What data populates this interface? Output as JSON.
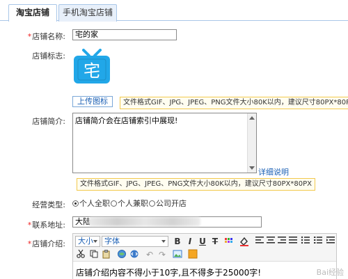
{
  "tabs": [
    {
      "label": "淘宝店铺",
      "active": true
    },
    {
      "label": "手机淘宝店铺",
      "active": false
    }
  ],
  "form": {
    "shop_name": {
      "label": "店铺名称:",
      "required": true,
      "value": "宅的家"
    },
    "shop_logo": {
      "label": "店铺标志:",
      "logo_char": "宅",
      "upload_label": "上传图标",
      "hint": "文件格式GIF、JPG、JPEG、PNG文件大小80K以内，建议尺寸80PX*80PX"
    },
    "shop_intro": {
      "label": "店铺简介:",
      "value": "店铺简介会在店铺索引中展现!",
      "help_link": "详细说明",
      "hint": "文件格式GIF、JPG、JPEG、PNG文件大小80K以内，建议尺寸80PX*80PX"
    },
    "business_type": {
      "label": "经营类型:",
      "options": [
        "个人全职",
        "个人兼职",
        "公司开店"
      ],
      "selected": 0
    },
    "address": {
      "label": "联系地址:",
      "required": true,
      "value": "大陆"
    },
    "shop_desc": {
      "label": "店铺介绍:",
      "required": true,
      "font_size": "大小",
      "font_family": "字体",
      "placeholder_text": "店铺介绍内容不得小于10字,且不得多于25000字!"
    }
  },
  "colors": {
    "accent": "#1a5fb4",
    "required": "#e22222",
    "hint_border": "#f2c94c",
    "logo": "#21a7e8"
  },
  "watermark": "Bai经验"
}
